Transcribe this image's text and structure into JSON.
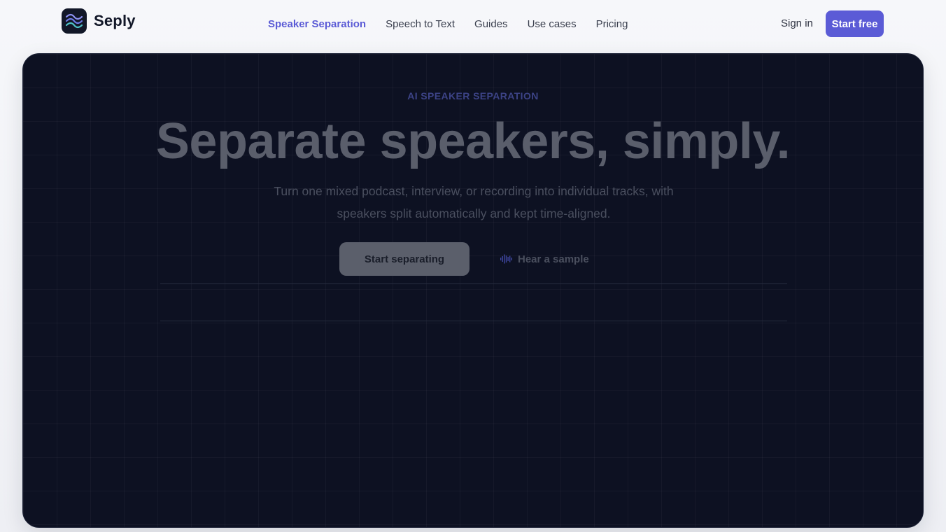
{
  "header": {
    "brand": "Seply",
    "logo_icon": "waves-icon",
    "nav": [
      {
        "label": "Speaker Separation",
        "active": true
      },
      {
        "label": "Speech to Text",
        "active": false
      },
      {
        "label": "Guides",
        "active": false
      },
      {
        "label": "Use cases",
        "active": false
      },
      {
        "label": "Pricing",
        "active": false
      }
    ],
    "sign_in": "Sign in",
    "start_free": "Start free"
  },
  "hero": {
    "eyebrow": "AI SPEAKER SEPARATION",
    "headline": "Separate speakers, simply.",
    "subtitle": "Turn one mixed podcast, interview, or recording into individual tracks, with speakers split automatically and kept time-aligned.",
    "cta_primary": "Start separating",
    "cta_secondary": "Hear a sample",
    "cta_secondary_icon": "audio-wave-icon"
  },
  "colors": {
    "accent": "#5b5bd6",
    "hero_bg": "#0d1122",
    "page_bg": "#f2f3f7"
  }
}
